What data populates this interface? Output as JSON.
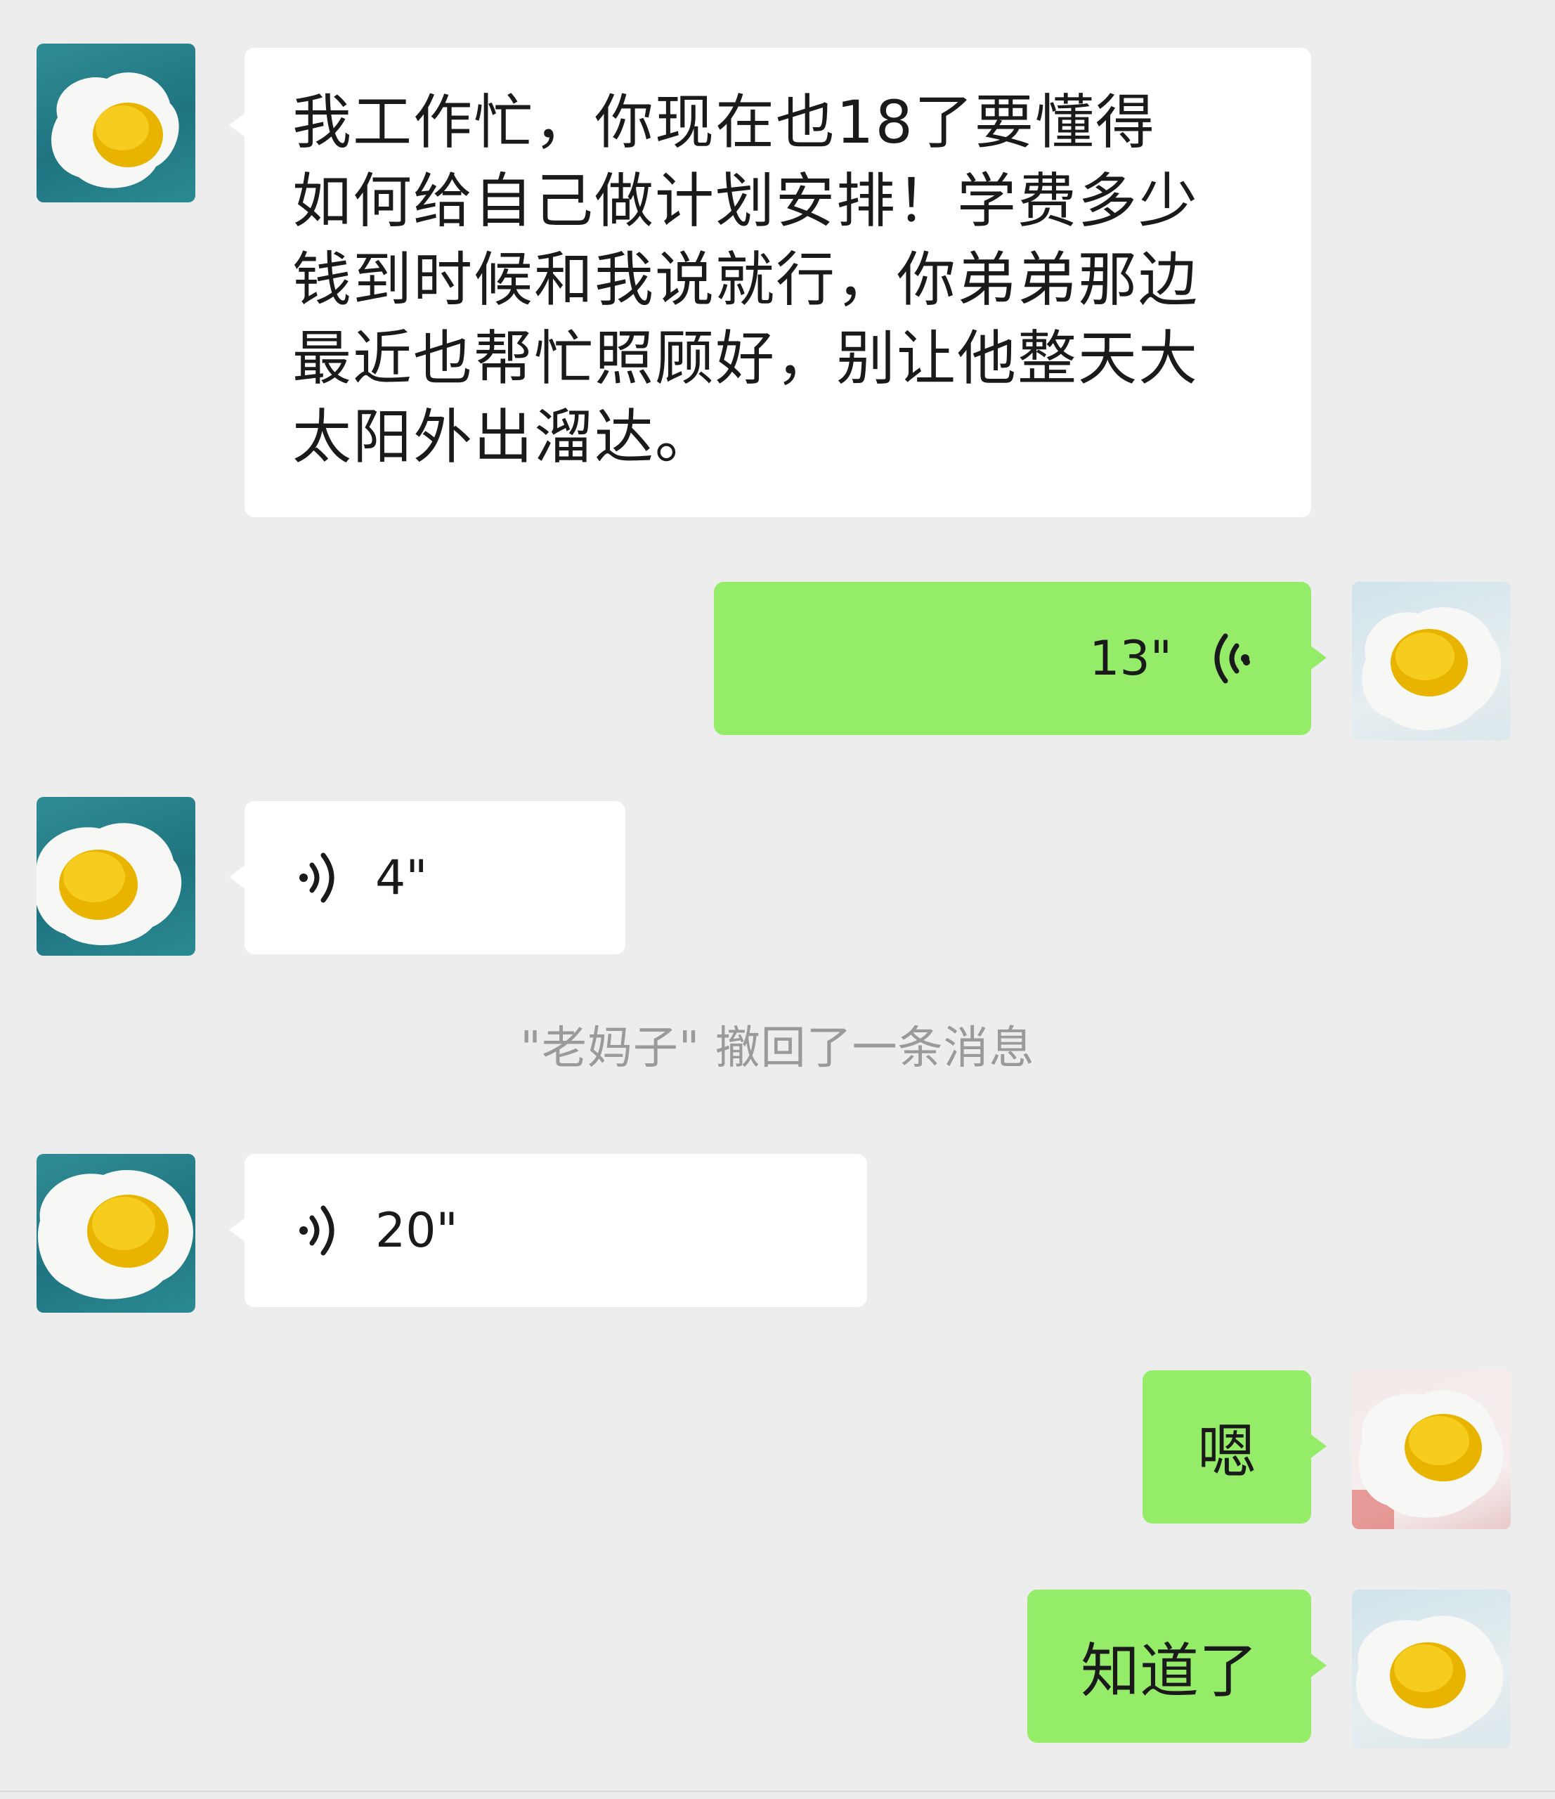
{
  "chat": {
    "messages": [
      {
        "side": "left",
        "type": "text",
        "text": "我工作忙，你现在也18了要懂得\n如何给自己做计划安排！学费多少\n钱到时候和我说就行，你弟弟那边\n最近也帮忙照顾好，别让他整天大\n太阳外出溜达。",
        "avatar_icon": "fried-egg-avatar-icon"
      },
      {
        "side": "right",
        "type": "voice",
        "duration": "13\"",
        "avatar_icon": "fried-egg-avatar-icon"
      },
      {
        "side": "left",
        "type": "voice",
        "duration": "4\"",
        "avatar_icon": "fried-egg-avatar-icon"
      },
      {
        "side": "left",
        "type": "voice",
        "duration": "20\"",
        "avatar_icon": "fried-egg-avatar-icon"
      },
      {
        "side": "right",
        "type": "text",
        "text": "嗯",
        "avatar_icon": "fried-egg-avatar-icon"
      },
      {
        "side": "right",
        "type": "text",
        "text": "知道了",
        "avatar_icon": "fried-egg-avatar-icon"
      }
    ],
    "system_notice": "\"老妈子\" 撤回了一条消息"
  },
  "colors": {
    "background": "#ededed",
    "incoming_bubble": "#ffffff",
    "outgoing_bubble": "#95ec69",
    "notice_text": "#9a9a9a"
  }
}
